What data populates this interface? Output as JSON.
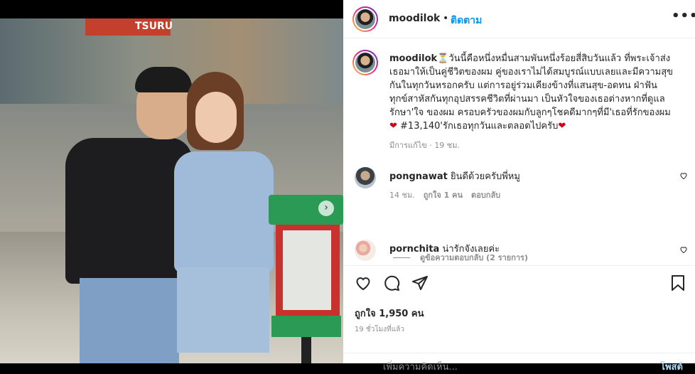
{
  "header": {
    "username": "moodilok",
    "separator": "•",
    "follow_label": "ติดตาม",
    "more_label": "•••"
  },
  "photo": {
    "sign_text": "TSURU",
    "total_images": 5,
    "active_image_index": 0
  },
  "caption": {
    "username": "moodilok",
    "emoji_hourglass": "⏳",
    "text_part1": "วันนี้คือหนึ่งหมื่นสามพันหนึ่งร้อยสี่สิบวันแล้ว ที่พระเจ้าส่งเธอมาให้เป็นคู่ชีวิตของผม คู่ของเราไม่ได้สมบูรณ์แบบเลยและมีความสุขกันในทุกวันหรอกครับ แต่การอยู่ร่วมเคียงข้างที่แสนสุข-อดทน ฝ่าฟันทุกข์สาหัสกันทุกอุปสรรคชีวิตที่ผ่านมา เป็นหัวใจของเธอต่างหากที่ดูแลรักษา'ใจ ของผม ครอบครัวของผมกับลูกๆโชคดีมากๆที่มี'เธอที่รักของผม",
    "heart1": "❤",
    "text_part2": " #13,140'รักเธอทุกวันและตลอดไปครับ",
    "heart2": "❤",
    "edited": "มีการแก้ไข",
    "dot": " · ",
    "age": "19 ชม."
  },
  "comments": [
    {
      "username": "pongnawat",
      "text": "ยินดีด้วยครับพี่หมู",
      "age": "14 ชม.",
      "likes": "ถูกใจ 1 คน",
      "reply": "ตอบกลับ"
    },
    {
      "username": "pornchita",
      "text": "น่ารักจังเลยค่ะ",
      "age": "",
      "likes": "",
      "reply": ""
    }
  ],
  "view_replies": "ดูข้อความตอบกลับ (2 รายการ)",
  "actions": {
    "likes": "ถูกใจ 1,950 คน",
    "time": "19 ชั่วโมงที่แล้ว"
  },
  "add_comment": {
    "placeholder": "เพิ่มความคิดเห็น...",
    "post_label": "โพสต์"
  },
  "colors": {
    "accent": "#0095f6",
    "heart": "#d0021b",
    "text": "#262626",
    "muted": "#8e8e8e"
  }
}
